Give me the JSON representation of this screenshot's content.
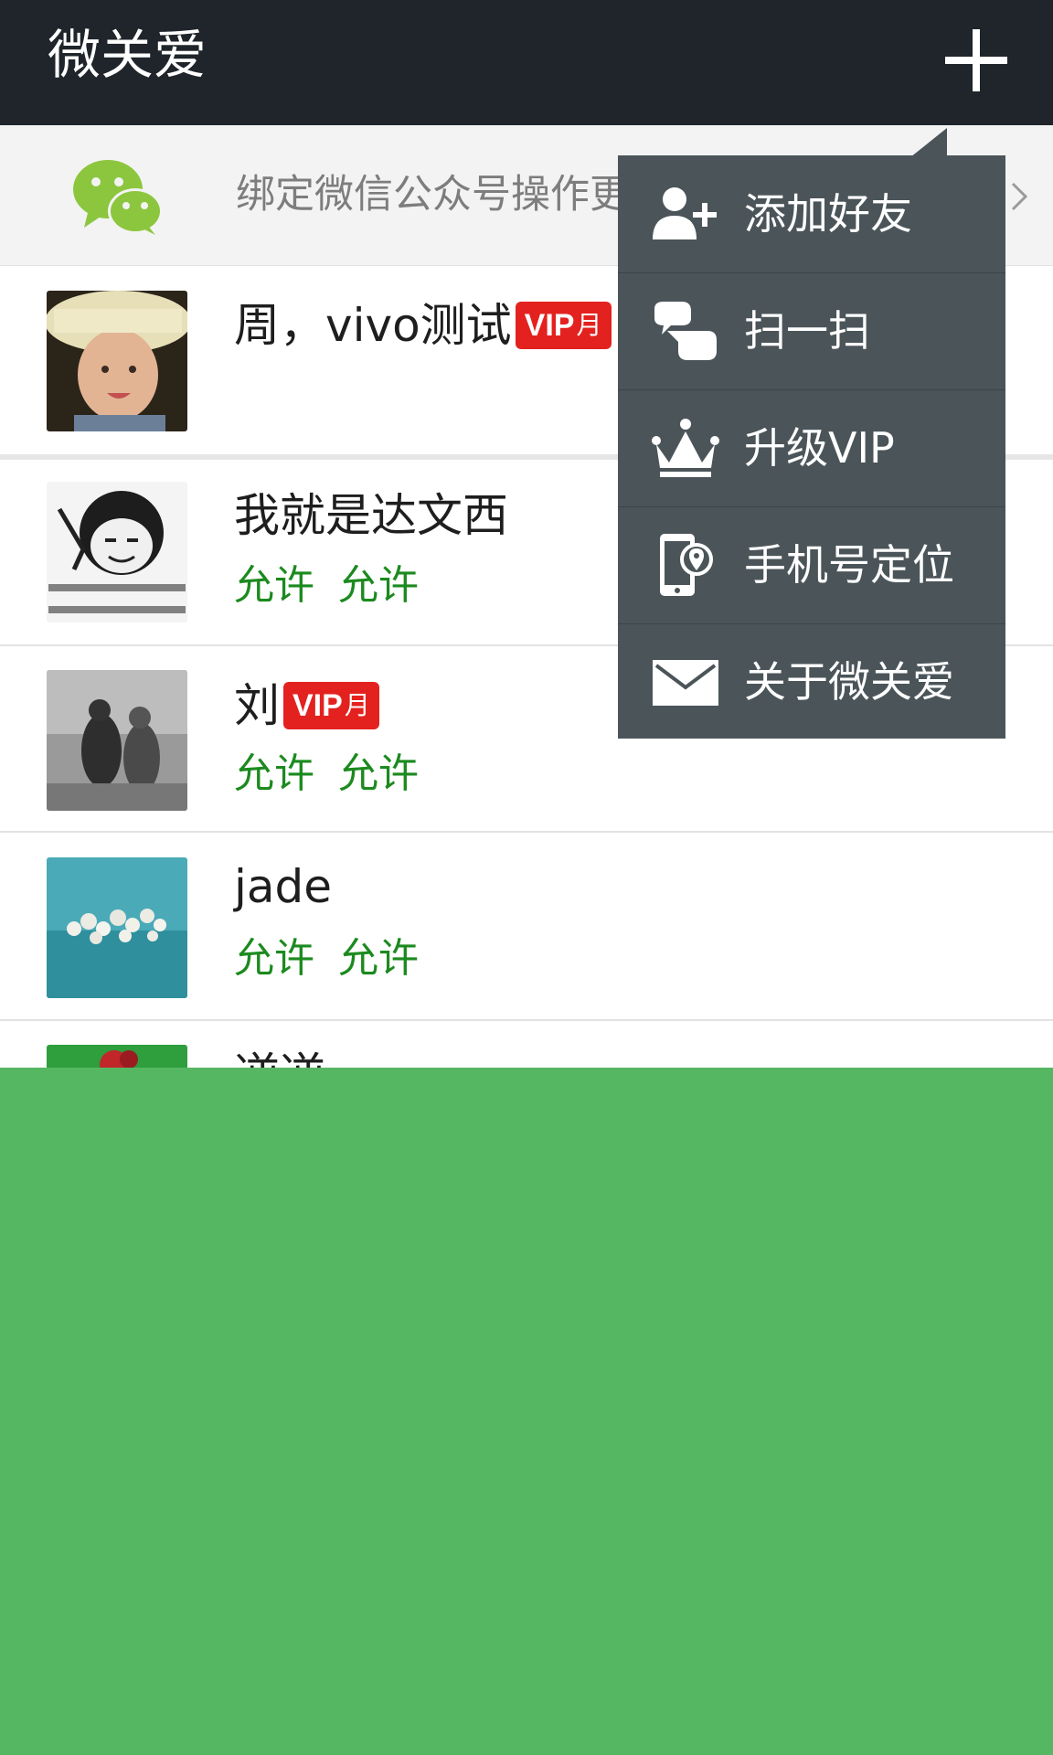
{
  "header": {
    "title": "微关爱",
    "add_icon": "plus-icon"
  },
  "banner": {
    "icon": "wechat-icon",
    "text": "绑定微信公众号操作更",
    "chevron_icon": "chevron-right-icon"
  },
  "contacts": [
    {
      "name": "周，vivo测试",
      "vip": true,
      "vip_label": "VIP",
      "vip_period": "月",
      "permissions": []
    },
    {
      "name": "我就是达文西",
      "vip": false,
      "permissions": [
        "允许",
        "允许"
      ]
    },
    {
      "name": "刘",
      "vip": true,
      "vip_label": "VIP",
      "vip_period": "月",
      "permissions": [
        "允许",
        "允许"
      ]
    },
    {
      "name": "jade",
      "vip": false,
      "permissions": [
        "允许",
        "允许"
      ]
    },
    {
      "name": "逆逆",
      "vip": false,
      "permissions": []
    }
  ],
  "menu": {
    "items": [
      {
        "label": "添加好友",
        "icon": "add-friend-icon"
      },
      {
        "label": "扫一扫",
        "icon": "scan-icon"
      },
      {
        "label": "升级VIP",
        "icon": "crown-icon"
      },
      {
        "label": "手机号定位",
        "icon": "phone-location-icon"
      },
      {
        "label": "关于微关爱",
        "icon": "mail-icon"
      }
    ]
  },
  "colors": {
    "header_bg": "#1f252a",
    "menu_bg": "#4b5559",
    "permission_text": "#1c8a1f",
    "vip_badge": "#e3221f",
    "overlay_green": "#55b762"
  }
}
